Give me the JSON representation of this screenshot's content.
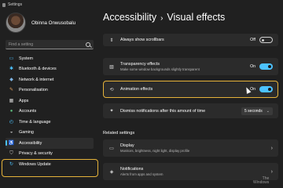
{
  "window": {
    "title": "Settings"
  },
  "user": {
    "name": "Obinna Onwusobalu"
  },
  "search": {
    "placeholder": "Find a setting"
  },
  "sidebar": {
    "items": [
      {
        "label": "System",
        "icon": "monitor-icon",
        "glyph": "▭",
        "color": "#4cc2ff"
      },
      {
        "label": "Bluetooth & devices",
        "icon": "bluetooth-icon",
        "glyph": "✱",
        "color": "#4cc2ff"
      },
      {
        "label": "Network & internet",
        "icon": "wifi-icon",
        "glyph": "◆",
        "color": "#7fb6e6"
      },
      {
        "label": "Personalisation",
        "icon": "brush-icon",
        "glyph": "✎",
        "color": "#e0a060"
      },
      {
        "label": "Apps",
        "icon": "apps-icon",
        "glyph": "▦",
        "color": "#cfcfcf"
      },
      {
        "label": "Accounts",
        "icon": "person-icon",
        "glyph": "●",
        "color": "#5fbf7f"
      },
      {
        "label": "Time & language",
        "icon": "globe-clock-icon",
        "glyph": "◴",
        "color": "#4cc2ff"
      },
      {
        "label": "Gaming",
        "icon": "gamepad-icon",
        "glyph": "◒",
        "color": "#cfcfcf"
      },
      {
        "label": "Accessibility",
        "icon": "accessibility-icon",
        "glyph": "♿",
        "color": "#4cc2ff",
        "active": true
      },
      {
        "label": "Privacy & security",
        "icon": "shield-icon",
        "glyph": "⛉",
        "color": "#cfcfcf"
      },
      {
        "label": "Windows Update",
        "icon": "update-icon",
        "glyph": "↻",
        "color": "#4cc2ff"
      }
    ]
  },
  "main": {
    "breadcrumb_parent": "Accessibility",
    "breadcrumb_sep": "›",
    "breadcrumb_current": "Visual effects",
    "settings": [
      {
        "title": "Always show scrollbars",
        "subtitle": "",
        "state": "Off",
        "icon": "scrollbar-icon",
        "glyph": "⇕"
      },
      {
        "title": "Transparency effects",
        "subtitle": "Make some window backgrounds slightly transparent",
        "state": "On",
        "icon": "transparency-icon",
        "glyph": "▧"
      },
      {
        "title": "Animation effects",
        "subtitle": "",
        "state": "On",
        "icon": "animation-icon",
        "glyph": "⟲"
      }
    ],
    "dismiss": {
      "title": "Dismiss notifications after this amount of time",
      "value": "5 seconds",
      "icon": "bell-icon",
      "glyph": "✦"
    },
    "related_label": "Related settings",
    "related": [
      {
        "title": "Display",
        "subtitle": "Monitors, brightness, night light, display profile",
        "icon": "display-icon",
        "glyph": "▭"
      },
      {
        "title": "Notifications",
        "subtitle": "Alerts from apps and system",
        "icon": "notification-icon",
        "glyph": "◈"
      }
    ]
  },
  "watermark": {
    "line1": "The",
    "line2": "Windows"
  },
  "colors": {
    "accent": "#4cc2ff",
    "highlight": "#e6b33a",
    "background": "#202020",
    "card": "#2b2b2b"
  }
}
